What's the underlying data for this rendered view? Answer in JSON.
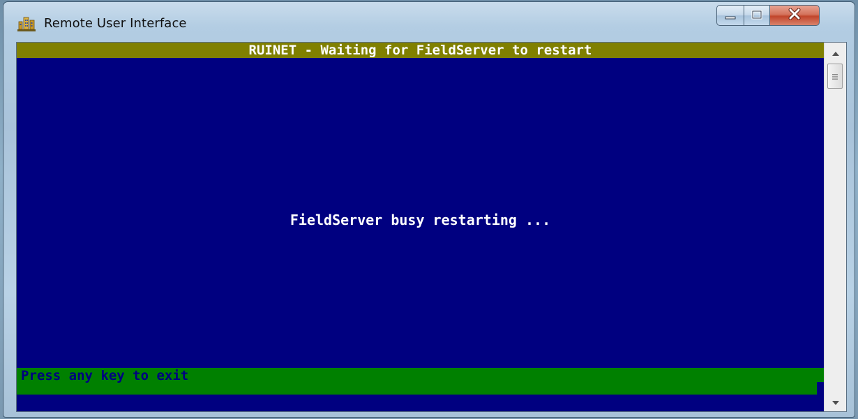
{
  "window": {
    "title": "Remote User Interface",
    "app_icon": "building-icon",
    "controls": {
      "minimize_icon": "minimize-icon",
      "maximize_icon": "maximize-icon",
      "close_icon": "close-icon"
    }
  },
  "console": {
    "header": "RUINET - Waiting for FieldServer to restart",
    "message": "FieldServer busy restarting ...",
    "footer": "Press any key to exit"
  },
  "colors": {
    "console_background": "#000080",
    "header_bar": "#808000",
    "footer_bar": "#008000",
    "console_text": "#ffffff",
    "footer_text": "#000080",
    "close_button": "#c1452b"
  },
  "scrollbar": {
    "up_icon": "scroll-up-arrow-icon",
    "down_icon": "scroll-down-arrow-icon",
    "position": 0
  }
}
